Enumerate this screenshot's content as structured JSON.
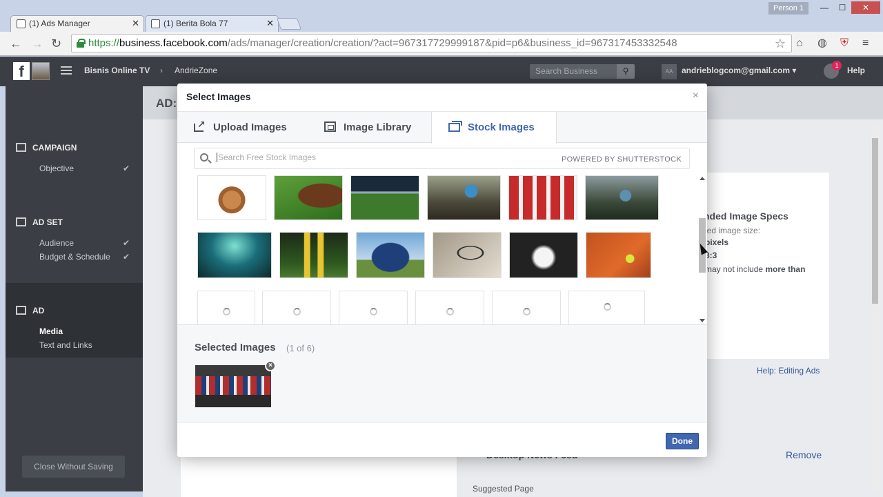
{
  "browser": {
    "profile": "Person 1",
    "tabs": [
      {
        "title": "(1) Ads Manager",
        "active": true
      },
      {
        "title": "(1) Berita Bola 77",
        "active": false
      }
    ],
    "url_scheme": "https://",
    "url_host": "business.facebook.com",
    "url_path": "/ads/manager/creation/creation/?act=967317729999187&pid=p6&business_id=967317453332548"
  },
  "fb": {
    "account": "Bisnis Online TV",
    "page": "AndrieZone",
    "search_placeholder": "Search Business",
    "user_initials": "AA",
    "user_email": "andrieblogcom@gmail.com",
    "notif_count": "1",
    "help": "Help"
  },
  "sidebar": {
    "campaign": "CAMPAIGN",
    "objective": "Objective",
    "adset": "AD SET",
    "audience": "Audience",
    "budget": "Budget & Schedule",
    "ad": "AD",
    "media": "Media",
    "text_links": "Text and Links",
    "close": "Close Without Saving"
  },
  "background": {
    "ad_title": "AD:",
    "specs_title": "nded Image Specs",
    "spec_line1": "led image size:",
    "spec_line2": "pixels",
    "spec_line3": "8:3",
    "spec_line4_a": "may not include",
    "spec_line4_b": "more than",
    "help_link": "Help: Editing Ads",
    "desktop": "Desktop News Feed",
    "remove": "Remove",
    "suggested": "Suggested Page"
  },
  "dialog": {
    "title": "Select Images",
    "tabs": [
      "Upload Images",
      "Image Library",
      "Stock Images"
    ],
    "selected_tab": "Stock Images",
    "search_placeholder": "Search Free Stock Images",
    "powered_by": "POWERED BY SHUTTERSTOCK",
    "selected_title": "Selected Images",
    "selected_count": "(1 of 6)",
    "done": "Done"
  },
  "colors": {
    "fb_blue": "#4267b2",
    "fb_dark": "#3b3f45"
  }
}
